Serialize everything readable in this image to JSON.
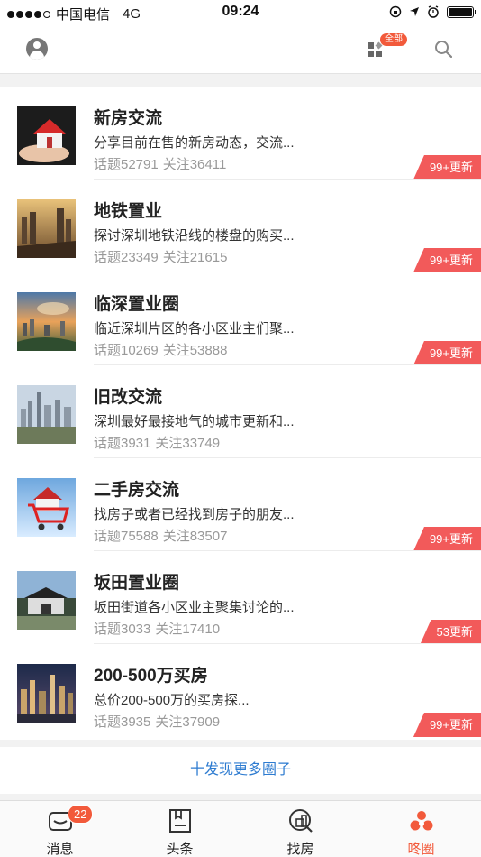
{
  "status_bar": {
    "carrier": "中国电信",
    "network": "4G",
    "time": "09:24"
  },
  "nav": {
    "all_badge": "全部"
  },
  "circles": [
    {
      "title": "新房交流",
      "desc": "分享目前在售的新房动态，交流...",
      "topics": "话题52791",
      "follows": "关注36411",
      "update": "99+更新"
    },
    {
      "title": "地铁置业",
      "desc": "探讨深圳地铁沿线的楼盘的购买...",
      "topics": "话题23349",
      "follows": "关注21615",
      "update": "99+更新"
    },
    {
      "title": "临深置业圈",
      "desc": "临近深圳片区的各小区业主们聚...",
      "topics": "话题10269",
      "follows": "关注53888",
      "update": "99+更新"
    },
    {
      "title": "旧改交流",
      "desc": "深圳最好最接地气的城市更新和...",
      "topics": "话题3931",
      "follows": "关注33749",
      "update": ""
    },
    {
      "title": "二手房交流",
      "desc": "找房子或者已经找到房子的朋友...",
      "topics": "话题75588",
      "follows": "关注83507",
      "update": "99+更新"
    },
    {
      "title": "坂田置业圈",
      "desc": "坂田街道各小区业主聚集讨论的...",
      "topics": "话题3033",
      "follows": "关注17410",
      "update": "53更新"
    },
    {
      "title": "200-500万买房",
      "desc": "总价200-500万的买房探...",
      "topics": "话题3935",
      "follows": "关注37909",
      "update": "99+更新"
    }
  ],
  "more_link": "十发现更多圈子",
  "tabbar": {
    "messages": {
      "label": "消息",
      "badge": "22"
    },
    "headlines": {
      "label": "头条"
    },
    "find_house": {
      "label": "找房"
    },
    "circle": {
      "label": "咚圈"
    }
  },
  "colors": {
    "accent": "#f25a3b",
    "update_tag": "#f25a5a",
    "link": "#2d7bd0"
  }
}
